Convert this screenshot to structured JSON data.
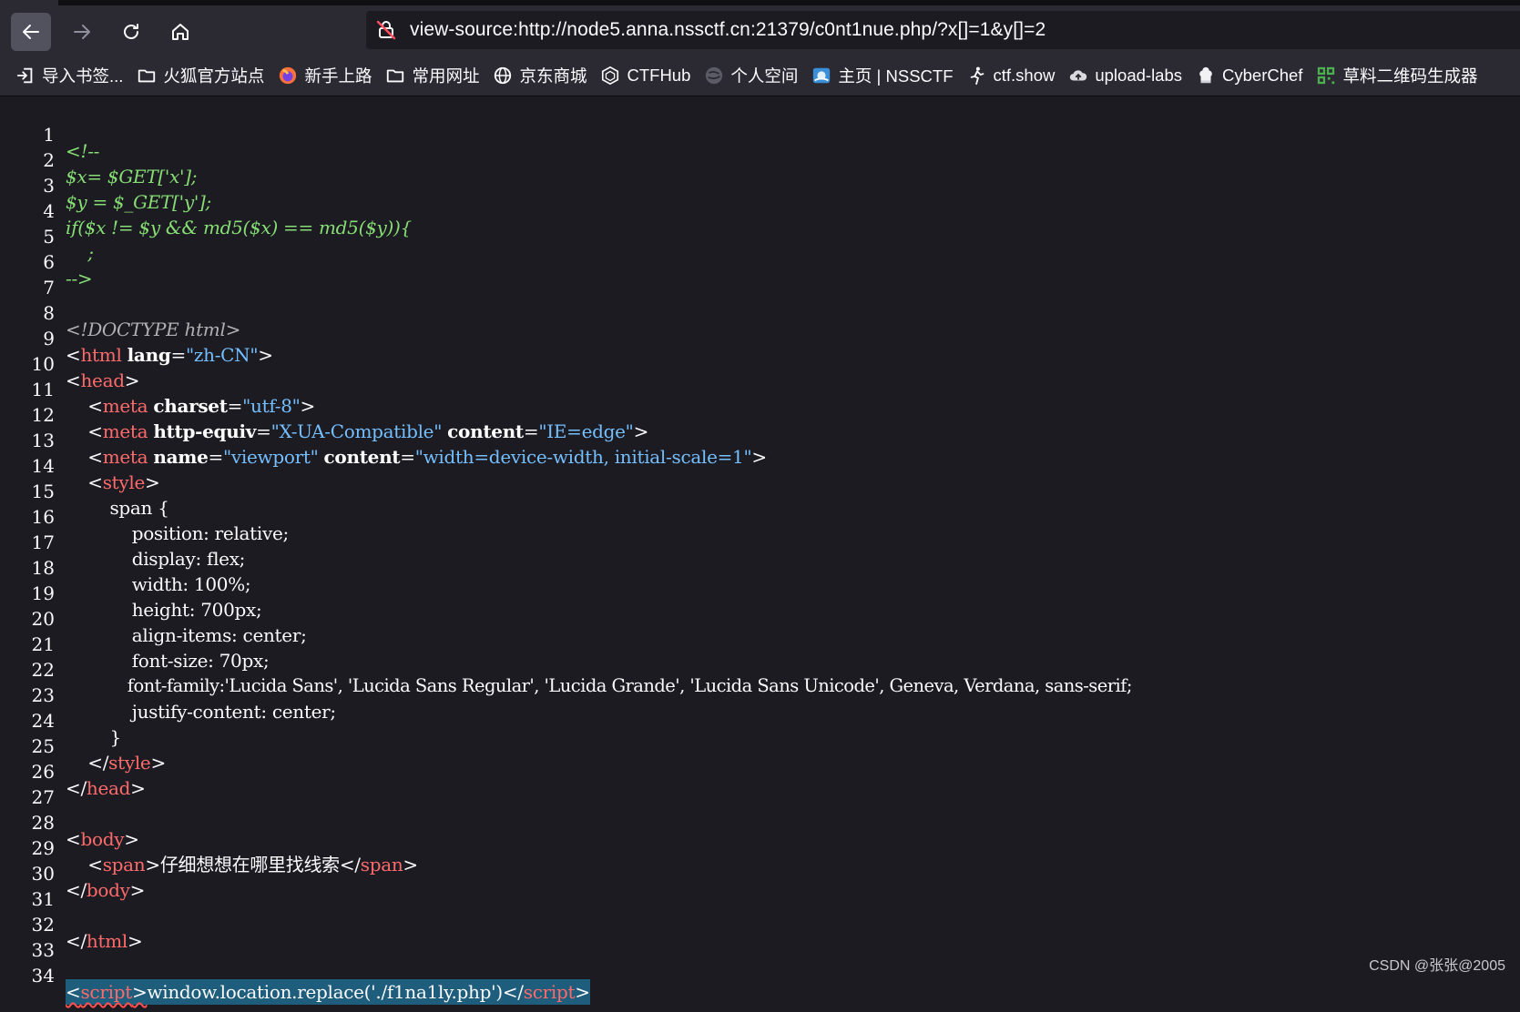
{
  "browser": {
    "url": "view-source:http://node5.anna.nssctf.cn:21379/c0nt1nue.php/?x[]=1&y[]=2",
    "colors": {
      "chrome": "#2b2a33",
      "content": "#1c1b22",
      "active_button": "#52525e"
    }
  },
  "bookmarks": [
    {
      "label": "导入书签...",
      "icon": "import-icon"
    },
    {
      "label": "火狐官方站点",
      "icon": "folder-icon"
    },
    {
      "label": "新手上路",
      "icon": "firefox-icon"
    },
    {
      "label": "常用网址",
      "icon": "folder-icon"
    },
    {
      "label": "京东商城",
      "icon": "globe-icon"
    },
    {
      "label": "CTFHub",
      "icon": "cube-icon"
    },
    {
      "label": "个人空间",
      "icon": "sphere-icon"
    },
    {
      "label": "主页 | NSSCTF",
      "icon": "nssctf-icon"
    },
    {
      "label": "ctf.show",
      "icon": "runner-icon"
    },
    {
      "label": "upload-labs",
      "icon": "cloud-icon"
    },
    {
      "label": "CyberChef",
      "icon": "chef-icon"
    },
    {
      "label": "草料二维码生成器",
      "icon": "qr-icon"
    }
  ],
  "source": {
    "line_numbers": [
      "1",
      "2",
      "3",
      "4",
      "5",
      "6",
      "7",
      "8",
      "9",
      "10",
      "11",
      "12",
      "13",
      "14",
      "15",
      "16",
      "17",
      "18",
      "19",
      "20",
      "21",
      "22",
      "23",
      "24",
      "25",
      "26",
      "27",
      "28",
      "29",
      "30",
      "31",
      "32",
      "33",
      "34"
    ],
    "comment": {
      "l1": "<!--",
      "l2": "$x= $GET['x'];",
      "l3": "$y = $_GET['y'];",
      "l4": "if($x != $y && md5($x) == md5($y)){",
      "l5": "    ;",
      "l6": "-->"
    },
    "doctype": "<!DOCTYPE html>",
    "tags": {
      "html": "html",
      "head": "head",
      "meta": "meta",
      "style": "style",
      "body": "body",
      "span": "span",
      "script": "script"
    },
    "attrs": {
      "lang": "lang",
      "lang_val": "\"zh-CN\"",
      "charset": "charset",
      "charset_val": "\"utf-8\"",
      "http_equiv": "http-equiv",
      "http_equiv_val": "\"X-UA-Compatible\"",
      "content": "content",
      "content_val_ie": "\"IE=edge\"",
      "name": "name",
      "name_val": "\"viewport\"",
      "content_val_vp": "\"width=device-width, initial-scale=1\""
    },
    "css": {
      "l15": "        span {",
      "l16": "            position: relative;",
      "l17": "            display: flex;",
      "l18": "            width: 100%;",
      "l19": "            height: 700px;",
      "l20": "            align-items: center;",
      "l21": "            font-size: 70px;",
      "l22": "            font-family:'Lucida Sans', 'Lucida Sans Regular', 'Lucida Grande', 'Lucida Sans Unicode', Geneva, Verdana, sans-serif;",
      "l23": "            justify-content: center;",
      "l24": "        }"
    },
    "span_text": "仔细想想在哪里找线索",
    "script_text": "window.location.replace('./f1na1ly.php')"
  },
  "watermark": "CSDN @张张@2005"
}
